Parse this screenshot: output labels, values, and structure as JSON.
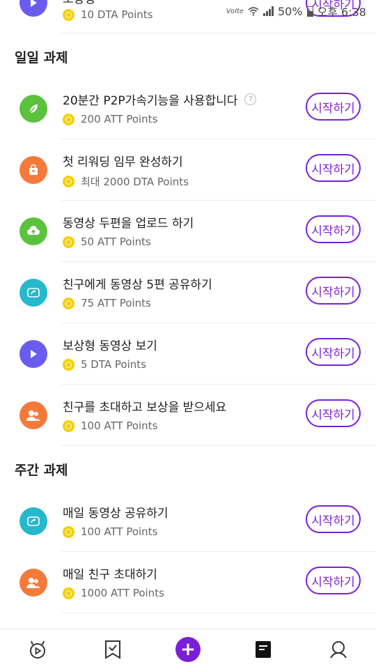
{
  "status_bar": {
    "network": "Volte",
    "battery": "50%",
    "time": "오후 6:38"
  },
  "partial_task": {
    "title": "보상형",
    "points": "10 DTA Points",
    "button": "시작하기",
    "icon": "play-icon",
    "icon_color": "#6b5cf0"
  },
  "daily": {
    "title": "일일 과제",
    "tasks": [
      {
        "title": "20분간 P2P가속기능을 사용합니다",
        "points": "200 ATT Points",
        "button": "시작하기",
        "icon": "leaf-icon",
        "icon_color": "#5bc23e",
        "help": "?"
      },
      {
        "title": "첫 리워딩 임무 완성하기",
        "points": "최대 2000 DTA Points",
        "button": "시작하기",
        "icon": "bag-icon",
        "icon_color": "#f47a3c"
      },
      {
        "title": "동영상 두편을 업로드 하기",
        "points": "50 ATT Points",
        "button": "시작하기",
        "icon": "cloud-upload-icon",
        "icon_color": "#5bc23e"
      },
      {
        "title": "친구에게 동영상 5편 공유하기",
        "points": "75 ATT Points",
        "button": "시작하기",
        "icon": "share-icon",
        "icon_color": "#26b8cc"
      },
      {
        "title": "보상형 동영상 보기",
        "points": "5 DTA Points",
        "button": "시작하기",
        "icon": "play-icon",
        "icon_color": "#6b5cf0"
      },
      {
        "title": "친구를 초대하고 보상을 받으세요",
        "points": "100 ATT Points",
        "button": "시작하기",
        "icon": "friends-icon",
        "icon_color": "#f47a3c"
      }
    ]
  },
  "weekly": {
    "title": "주간 과제",
    "tasks": [
      {
        "title": "매일 동영상 공유하기",
        "points": "100 ATT Points",
        "button": "시작하기",
        "icon": "share-icon",
        "icon_color": "#26b8cc"
      },
      {
        "title": "매일 친구 초대하기",
        "points": "1000 ATT Points",
        "button": "시작하기",
        "icon": "friends-icon",
        "icon_color": "#f47a3c"
      }
    ]
  },
  "bottom_nav": {
    "items": [
      "home-icon",
      "bookmark-check-icon",
      "plus-icon",
      "document-icon",
      "profile-icon"
    ],
    "accent": "#7a1fd8",
    "plus": "+"
  }
}
